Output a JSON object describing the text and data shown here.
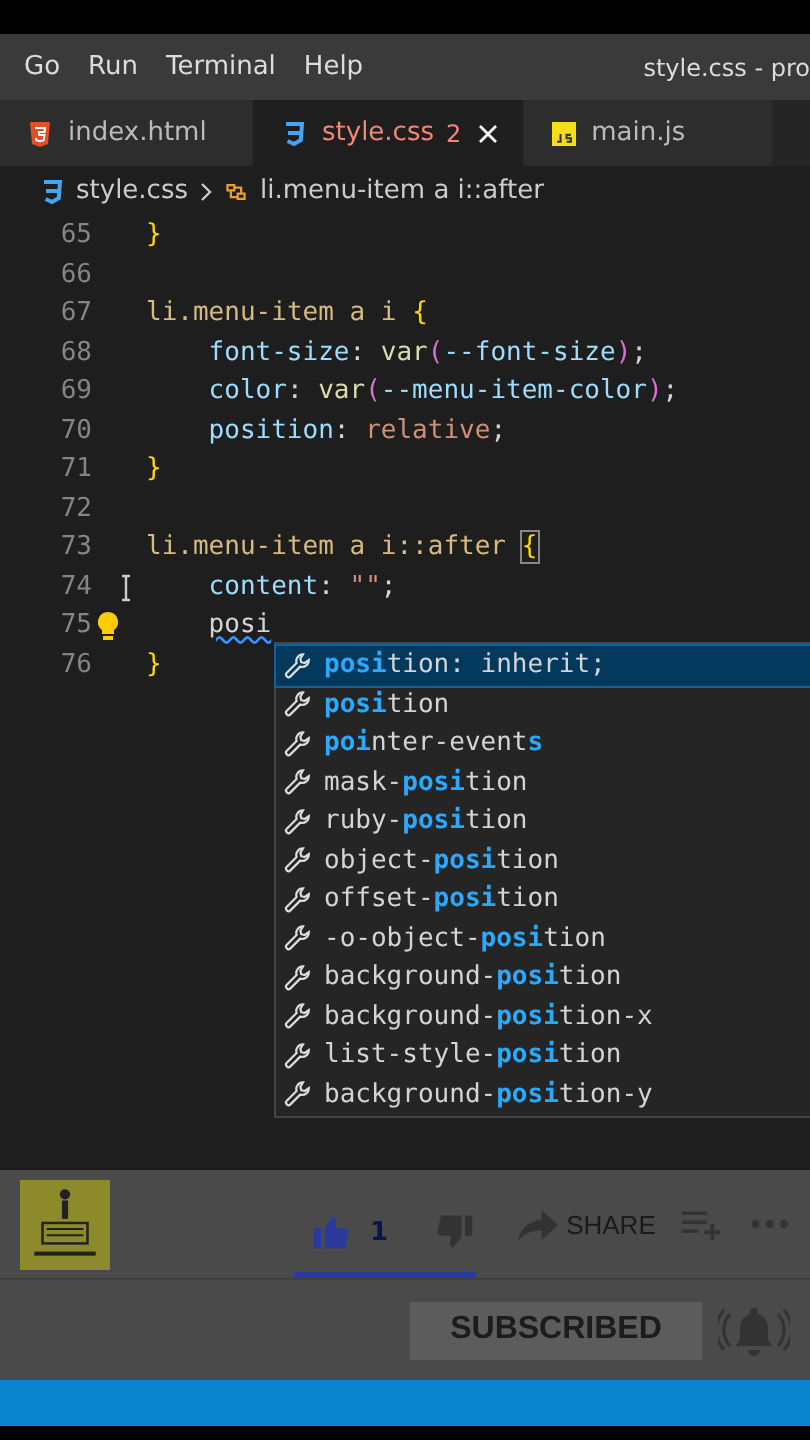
{
  "menu_bar": {
    "items": [
      "Go",
      "Run",
      "Terminal",
      "Help"
    ],
    "title": "style.css - pro"
  },
  "tabs": [
    {
      "label": "index.html",
      "kind": "html",
      "selected": false
    },
    {
      "label": "style.css",
      "kind": "css",
      "selected": true,
      "problems": "2"
    },
    {
      "label": "main.js",
      "kind": "js",
      "selected": false
    }
  ],
  "breadcrumb": {
    "file": "style.css",
    "symbol": "li.menu-item a i::after"
  },
  "lines": [
    {
      "number": "65",
      "indented": false,
      "tokens": [
        {
          "kind": "brace",
          "text": "}"
        }
      ]
    },
    {
      "number": "66"
    },
    {
      "number": "67",
      "indented": false,
      "tokens": [
        {
          "kind": "selector",
          "text": "li.menu-item a i "
        },
        {
          "kind": "brace",
          "text": "{"
        }
      ]
    },
    {
      "number": "68",
      "indented": true,
      "tokens": [
        {
          "kind": "property",
          "text": "font-size"
        },
        {
          "kind": "punct",
          "text": ": "
        },
        {
          "kind": "func",
          "text": "var"
        },
        {
          "kind": "paren",
          "text": "("
        },
        {
          "kind": "property",
          "text": "--font-size"
        },
        {
          "kind": "paren",
          "text": ")"
        },
        {
          "kind": "punct",
          "text": ";"
        }
      ]
    },
    {
      "number": "69",
      "indented": true,
      "tokens": [
        {
          "kind": "property",
          "text": "color"
        },
        {
          "kind": "punct",
          "text": ": "
        },
        {
          "kind": "func",
          "text": "var"
        },
        {
          "kind": "paren",
          "text": "("
        },
        {
          "kind": "property",
          "text": "--menu-item-color"
        },
        {
          "kind": "paren",
          "text": ")"
        },
        {
          "kind": "punct",
          "text": ";"
        }
      ]
    },
    {
      "number": "70",
      "indented": true,
      "tokens": [
        {
          "kind": "property",
          "text": "position"
        },
        {
          "kind": "punct",
          "text": ": "
        },
        {
          "kind": "value",
          "text": "relative"
        },
        {
          "kind": "punct",
          "text": ";"
        }
      ]
    },
    {
      "number": "71",
      "indented": false,
      "tokens": [
        {
          "kind": "brace",
          "text": "}"
        }
      ]
    },
    {
      "number": "72"
    },
    {
      "number": "73",
      "indented": false,
      "tokens": [
        {
          "kind": "selector",
          "text": "li.menu-item a i::after "
        },
        {
          "kind": "matched-brace",
          "text": "{"
        }
      ]
    },
    {
      "number": "74",
      "indented": true,
      "tokens": [
        {
          "kind": "property",
          "text": "content"
        },
        {
          "kind": "punct",
          "text": ": "
        },
        {
          "kind": "value",
          "text": "\"\""
        },
        {
          "kind": "punct",
          "text": ";"
        }
      ]
    },
    {
      "number": "75",
      "indented": true,
      "lightbulb": true,
      "tokens": [
        {
          "kind": "error",
          "text": "posi"
        }
      ]
    },
    {
      "number": "76",
      "indented": false,
      "tokens": [
        {
          "kind": "brace",
          "text": "}"
        }
      ]
    }
  ],
  "suggestions": [
    {
      "selected": true,
      "parts": [
        {
          "text": "posi",
          "match": true
        },
        {
          "text": "tion: inherit;",
          "match": false
        }
      ]
    },
    {
      "selected": false,
      "parts": [
        {
          "text": "posi",
          "match": true
        },
        {
          "text": "tion",
          "match": false
        }
      ]
    },
    {
      "selected": false,
      "parts": [
        {
          "text": "poi",
          "match": true
        },
        {
          "text": "nter-event",
          "match": false
        },
        {
          "text": "s",
          "match": true
        }
      ]
    },
    {
      "selected": false,
      "parts": [
        {
          "text": "mask-",
          "match": false
        },
        {
          "text": "posi",
          "match": true
        },
        {
          "text": "tion",
          "match": false
        }
      ]
    },
    {
      "selected": false,
      "parts": [
        {
          "text": "ruby-",
          "match": false
        },
        {
          "text": "posi",
          "match": true
        },
        {
          "text": "tion",
          "match": false
        }
      ]
    },
    {
      "selected": false,
      "parts": [
        {
          "text": "object-",
          "match": false
        },
        {
          "text": "posi",
          "match": true
        },
        {
          "text": "tion",
          "match": false
        }
      ]
    },
    {
      "selected": false,
      "parts": [
        {
          "text": "offset-",
          "match": false
        },
        {
          "text": "posi",
          "match": true
        },
        {
          "text": "tion",
          "match": false
        }
      ]
    },
    {
      "selected": false,
      "parts": [
        {
          "text": "-o-object-",
          "match": false
        },
        {
          "text": "posi",
          "match": true
        },
        {
          "text": "tion",
          "match": false
        }
      ]
    },
    {
      "selected": false,
      "parts": [
        {
          "text": "background-",
          "match": false
        },
        {
          "text": "posi",
          "match": true
        },
        {
          "text": "tion",
          "match": false
        }
      ]
    },
    {
      "selected": false,
      "parts": [
        {
          "text": "background-",
          "match": false
        },
        {
          "text": "posi",
          "match": true
        },
        {
          "text": "tion-x",
          "match": false
        }
      ]
    },
    {
      "selected": false,
      "parts": [
        {
          "text": "list-style-",
          "match": false
        },
        {
          "text": "posi",
          "match": true
        },
        {
          "text": "tion",
          "match": false
        }
      ]
    },
    {
      "selected": false,
      "parts": [
        {
          "text": "background-",
          "match": false
        },
        {
          "text": "posi",
          "match": true
        },
        {
          "text": "tion-y",
          "match": false
        }
      ]
    }
  ],
  "video_bar": {
    "liked": true,
    "likes": "1",
    "disliked": false,
    "like_ratio": {
      "level": 1
    },
    "share": "SHARE",
    "subscribe": "SUBSCRIBED"
  }
}
